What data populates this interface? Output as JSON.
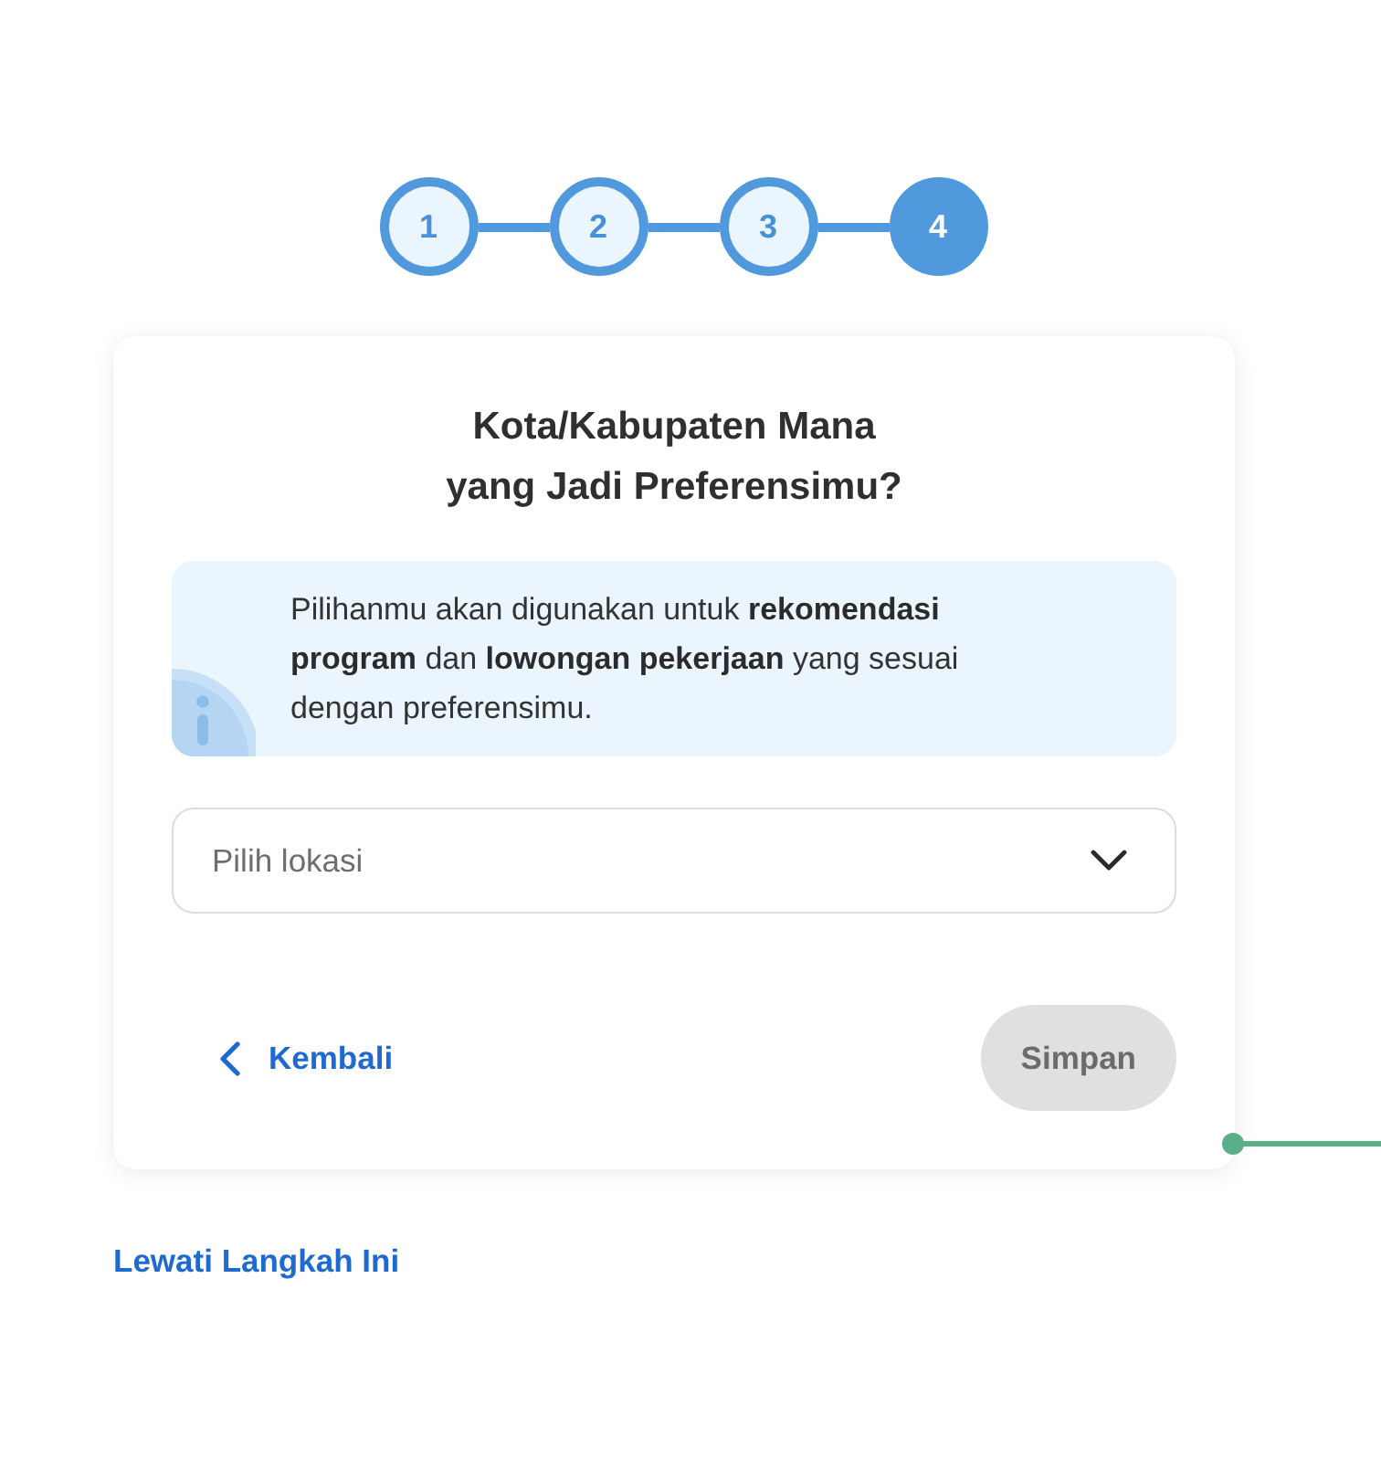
{
  "stepper": {
    "steps": [
      {
        "label": "1",
        "selected": false
      },
      {
        "label": "2",
        "selected": false
      },
      {
        "label": "3",
        "selected": false
      },
      {
        "label": "4",
        "selected": true
      }
    ]
  },
  "card": {
    "title": "Kota/Kabupaten Mana\nyang Jadi Preferensimu?",
    "info": {
      "text": "Pilihanmu akan digunakan untuk **rekomendasi program** dan **lowongan pekerjaan** yang sesuai dengan preferensimu."
    },
    "location_select": {
      "placeholder": "Pilih lokasi"
    },
    "back_button": {
      "label": "Kembali"
    },
    "save_button": {
      "label": "Simpan",
      "disabled": true
    }
  },
  "skip_link": {
    "label": "Lewati Langkah Ini"
  }
}
